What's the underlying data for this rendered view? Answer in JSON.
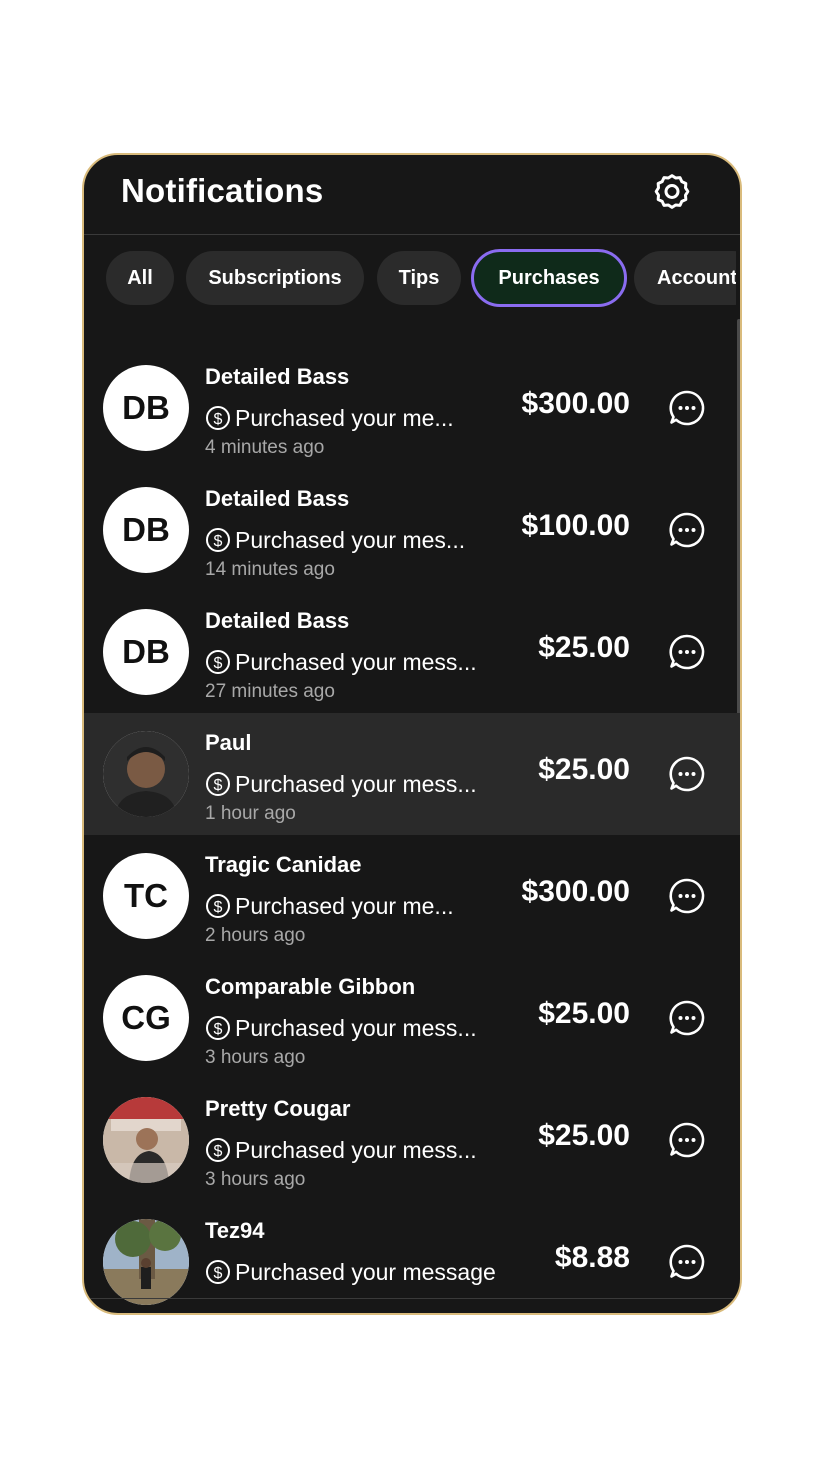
{
  "header": {
    "title": "Notifications",
    "settings_icon": "gear-icon"
  },
  "filters": [
    {
      "label": "All",
      "active": false
    },
    {
      "label": "Subscriptions",
      "active": false
    },
    {
      "label": "Tips",
      "active": false
    },
    {
      "label": "Purchases",
      "active": true
    },
    {
      "label": "Account",
      "active": false
    }
  ],
  "notifications": [
    {
      "name": "Detailed Bass",
      "initials": "DB",
      "message": "Purchased your me...",
      "time": "4 minutes ago",
      "amount": "$300.00"
    },
    {
      "name": "Detailed Bass",
      "initials": "DB",
      "message": "Purchased your mes...",
      "time": "14 minutes ago",
      "amount": "$100.00"
    },
    {
      "name": "Detailed Bass",
      "initials": "DB",
      "message": "Purchased your mess...",
      "time": "27 minutes ago",
      "amount": "$25.00"
    },
    {
      "name": "Paul",
      "initials": "",
      "message": "Purchased your mess...",
      "time": "1 hour ago",
      "amount": "$25.00",
      "highlighted": true
    },
    {
      "name": "Tragic Canidae",
      "initials": "TC",
      "message": "Purchased your me...",
      "time": "2 hours ago",
      "amount": "$300.00"
    },
    {
      "name": "Comparable Gibbon",
      "initials": "CG",
      "message": "Purchased your mess...",
      "time": "3 hours ago",
      "amount": "$25.00"
    },
    {
      "name": "Pretty Cougar",
      "initials": "",
      "message": "Purchased your mess...",
      "time": "3 hours ago",
      "amount": "$25.00"
    },
    {
      "name": "Tez94",
      "initials": "",
      "message": "Purchased your message",
      "time": "",
      "amount": "$8.88"
    }
  ],
  "colors": {
    "panel_bg": "#171717",
    "panel_border": "#d9bb7c",
    "active_chip_bg": "#0f2a1a",
    "active_chip_border": "#8a6cf0",
    "chip_bg": "#2b2b2b",
    "highlight_row": "#2a2a2a"
  }
}
